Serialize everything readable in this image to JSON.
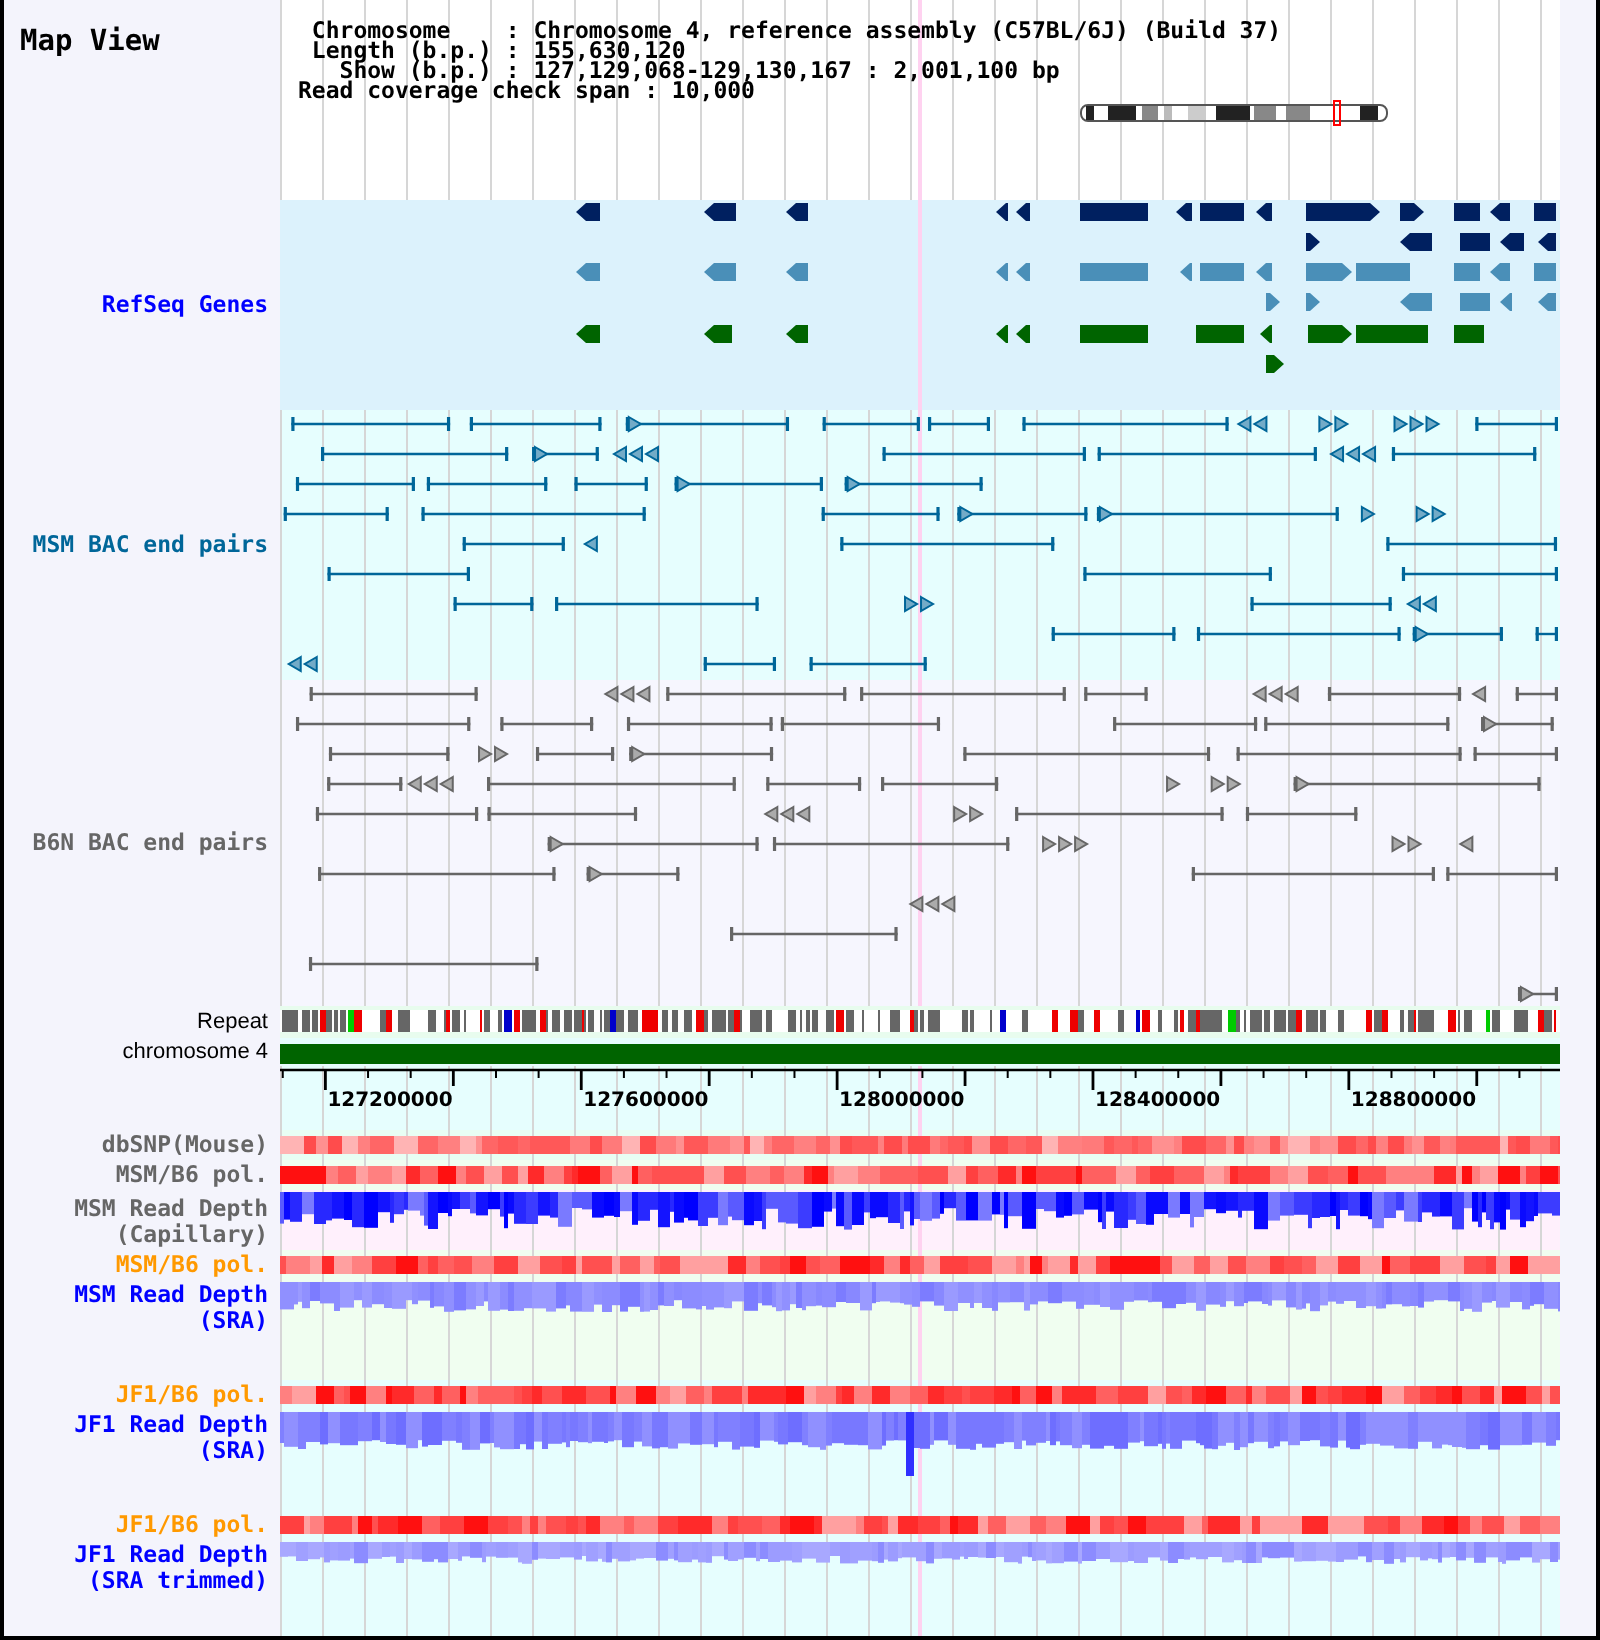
{
  "view": {
    "title": "Map View",
    "info_lines": [
      "Chromosome    : Chromosome 4, reference assembly (C57BL/6J) (Build 37)",
      "Length (b.p.) : 155,630,120",
      "Show (b.p.) : 127,129,068-129,130,167 : 2,001,100 bp"
    ],
    "coverage_span": "Read coverage check span : 10,000"
  },
  "tracks": [
    {
      "kind": "genes",
      "label": "RefSeq Genes",
      "color": "#0000ff"
    },
    {
      "kind": "pairs",
      "label": "MSM BAC end pairs",
      "color": "#006699"
    },
    {
      "kind": "pairs",
      "label": "B6N BAC end pairs",
      "color": "#666666"
    },
    {
      "kind": "repeat",
      "label": "Repeat",
      "color": "#000000"
    },
    {
      "kind": "chromosome",
      "label": "chromosome 4",
      "color": "#000000"
    },
    {
      "kind": "axis",
      "ticks": [
        "127200000",
        "127600000",
        "128000000",
        "128400000",
        "128800000"
      ]
    },
    {
      "kind": "heat",
      "label": "dbSNP(Mouse)",
      "color": "#666666"
    },
    {
      "kind": "heat",
      "label": "MSM/B6 pol.",
      "color": "#666666"
    },
    {
      "kind": "depth",
      "label": "MSM Read Depth (Capillary)",
      "color": "#666666"
    },
    {
      "kind": "heat",
      "label": "MSM/B6 pol.",
      "color": "#ff9900"
    },
    {
      "kind": "depth",
      "label": "MSM Read Depth (SRA)",
      "color": "#0000ff"
    },
    {
      "kind": "heat",
      "label": "JF1/B6 pol.",
      "color": "#ff9900"
    },
    {
      "kind": "depth",
      "label": "JF1 Read Depth (SRA)",
      "color": "#0000ff"
    },
    {
      "kind": "heat",
      "label": "JF1/B6 pol.",
      "color": "#ff9900"
    },
    {
      "kind": "depth",
      "label": "JF1 Read Depth (SRA trimmed)",
      "color": "#0000ff"
    }
  ]
}
